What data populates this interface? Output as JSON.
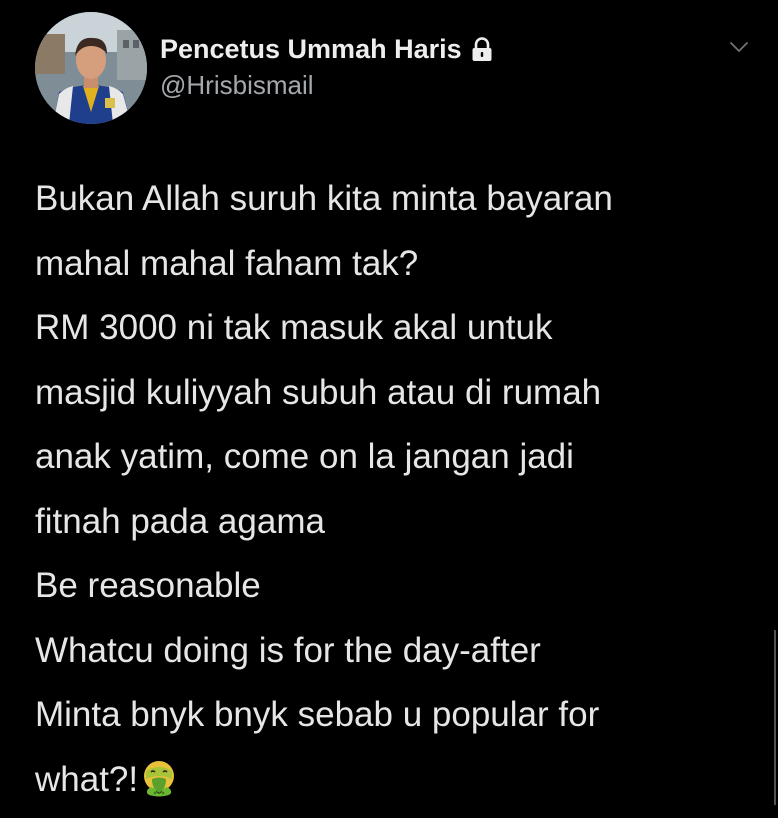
{
  "author": {
    "display_name": "Pencetus Ummah Haris",
    "handle": "@Hrisbismail",
    "protected_icon": "lock-icon",
    "avatar_icon": "profile-photo"
  },
  "menu": {
    "icon": "chevron-down-icon"
  },
  "tweet": {
    "lines": [
      "Bukan Allah suruh kita minta bayaran",
      "mahal mahal faham tak?",
      "RM 3000 ni tak masuk akal untuk",
      "masjid kuliyyah subuh atau di rumah",
      "anak yatim, come on la jangan jadi",
      "fitnah pada agama",
      "Be reasonable",
      "Whatcu doing is for the day-after",
      "Minta bnyk bnyk sebab u popular for",
      "what?!"
    ],
    "emoji": "vomiting-face-emoji"
  },
  "colors": {
    "background": "#000000",
    "name_text": "#eeeeee",
    "handle_text": "#a4a9ad",
    "body_text": "#e6e6e6"
  }
}
